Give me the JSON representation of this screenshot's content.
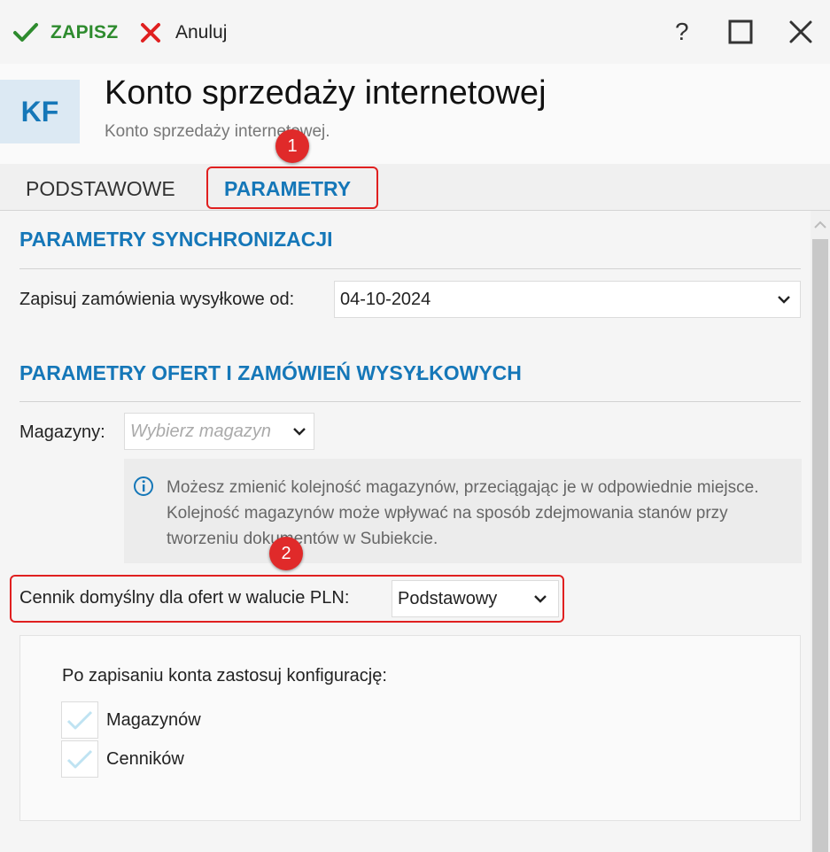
{
  "toolbar": {
    "save_label": "ZAPISZ",
    "cancel_label": "Anuluj",
    "help_label": "?"
  },
  "header": {
    "badge": "KF",
    "title": "Konto sprzedaży internetowej",
    "subtitle": "Konto sprzedaży internetowej."
  },
  "tabs": [
    {
      "label": "PODSTAWOWE",
      "active": false
    },
    {
      "label": "PARAMETRY",
      "active": true
    }
  ],
  "annotations": [
    "1",
    "2"
  ],
  "sync": {
    "title": "PARAMETRY SYNCHRONIZACJI",
    "orders_label": "Zapisuj zamówienia wysyłkowe od:",
    "orders_value": "04-10-2024"
  },
  "offers": {
    "title": "PARAMETRY OFERT I ZAMÓWIEŃ WYSYŁKOWYCH",
    "warehouses_label": "Magazyny:",
    "warehouses_placeholder": "Wybierz magazyn",
    "info_text": "Możesz zmienić kolejność magazynów, przeciągając je w odpowiednie miejsce. Kolejność magazynów może wpływać na sposób zdejmowania stanów przy tworzeniu dokumentów w Subiekcie.",
    "pricelist_label": "Cennik domyślny dla ofert w walucie PLN:",
    "pricelist_value": "Podstawowy"
  },
  "config": {
    "title": "Po zapisaniu konta zastosuj konfigurację:",
    "options": [
      {
        "label": "Magazynów",
        "checked": true
      },
      {
        "label": "Cenników",
        "checked": true
      }
    ]
  },
  "colors": {
    "accent": "#1577b8",
    "save_green": "#2e8b2e",
    "cancel_red": "#e02020",
    "highlight_red": "#e02020"
  }
}
